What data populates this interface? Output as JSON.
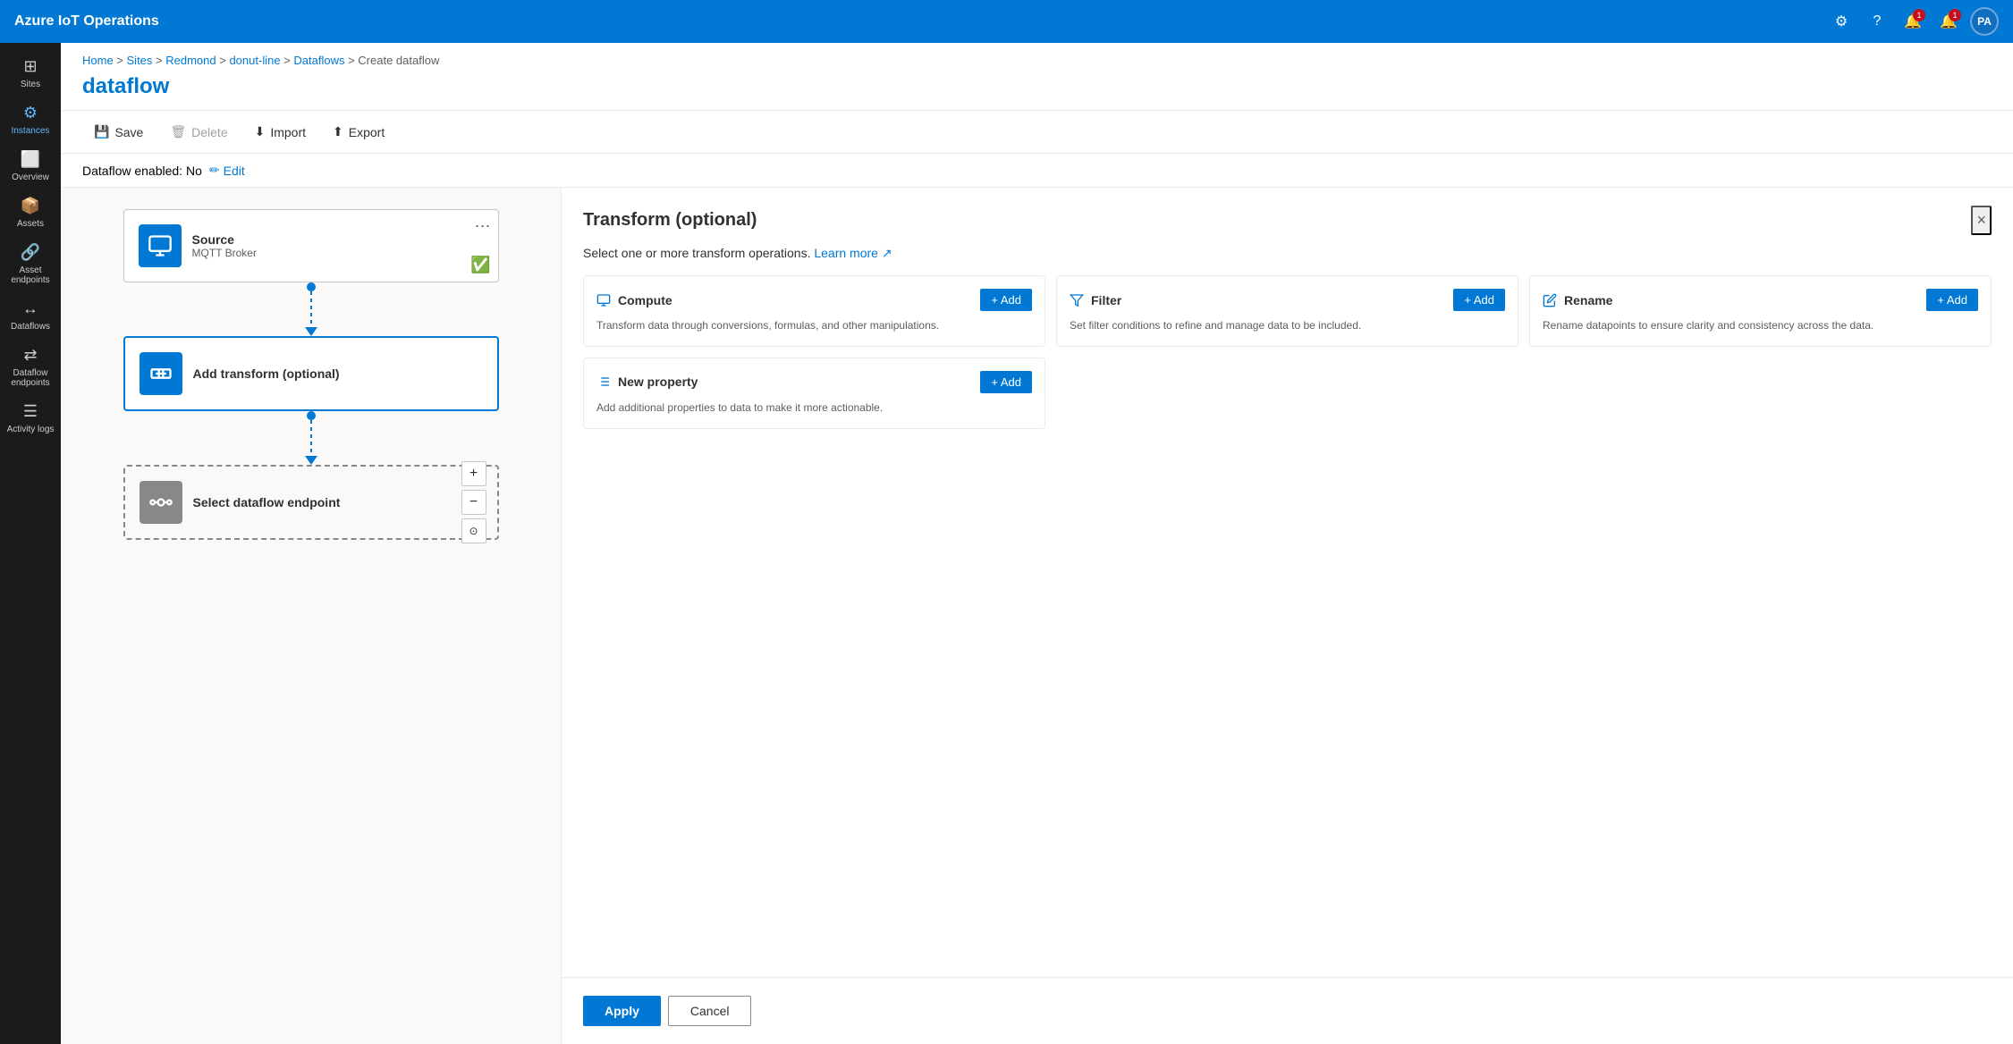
{
  "app": {
    "title": "Azure IoT Operations"
  },
  "topnav": {
    "title": "Azure IoT Operations",
    "avatar_initials": "PA"
  },
  "sidebar": {
    "items": [
      {
        "id": "sites",
        "label": "Sites",
        "icon": "⊞"
      },
      {
        "id": "instances",
        "label": "Instances",
        "icon": "⚙"
      },
      {
        "id": "overview",
        "label": "Overview",
        "icon": "⊡"
      },
      {
        "id": "assets",
        "label": "Assets",
        "icon": "📦"
      },
      {
        "id": "asset-endpoints",
        "label": "Asset endpoints",
        "icon": "🔗"
      },
      {
        "id": "dataflows",
        "label": "Dataflows",
        "icon": "↔"
      },
      {
        "id": "dataflow-endpoints",
        "label": "Dataflow endpoints",
        "icon": "⇄"
      },
      {
        "id": "activity-logs",
        "label": "Activity logs",
        "icon": "≡"
      }
    ]
  },
  "breadcrumb": {
    "parts": [
      "Home",
      "Sites",
      "Redmond",
      "donut-line",
      "Dataflows",
      "Create dataflow"
    ],
    "separators": [
      ">",
      ">",
      ">",
      ">",
      ">"
    ]
  },
  "page": {
    "title": "dataflow"
  },
  "toolbar": {
    "save_label": "Save",
    "delete_label": "Delete",
    "import_label": "Import",
    "export_label": "Export"
  },
  "status": {
    "text": "Dataflow enabled: No",
    "edit_label": "Edit"
  },
  "canvas": {
    "source_node": {
      "title": "Source",
      "subtitle": "MQTT Broker",
      "menu_label": "⋯"
    },
    "transform_node": {
      "title": "Add transform (optional)"
    },
    "endpoint_node": {
      "title": "Select dataflow endpoint"
    },
    "zoom_plus": "+",
    "zoom_minus": "−"
  },
  "panel": {
    "title": "Transform (optional)",
    "subtitle": "Select one or more transform operations.",
    "learn_more_label": "Learn more",
    "close_label": "×",
    "cards": [
      {
        "id": "compute",
        "icon": "⊞",
        "label": "Compute",
        "add_label": "+ Add",
        "description": "Transform data through conversions, formulas, and other manipulations."
      },
      {
        "id": "filter",
        "icon": "⊟",
        "label": "Filter",
        "add_label": "+ Add",
        "description": "Set filter conditions to refine and manage data to be included."
      },
      {
        "id": "rename",
        "icon": "⊠",
        "label": "Rename",
        "add_label": "+ Add",
        "description": "Rename datapoints to ensure clarity and consistency across the data."
      },
      {
        "id": "new-property",
        "icon": "≡",
        "label": "New property",
        "add_label": "+ Add",
        "description": "Add additional properties to data to make it more actionable."
      }
    ],
    "apply_label": "Apply",
    "cancel_label": "Cancel"
  }
}
